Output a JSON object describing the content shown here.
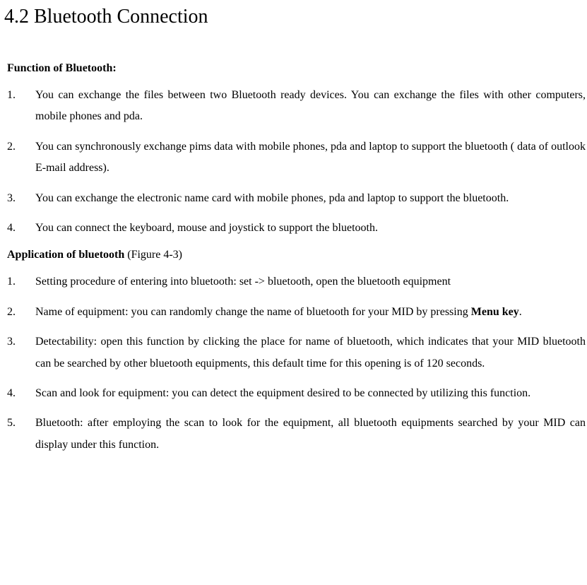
{
  "section_title": "4.2 Bluetooth Connection",
  "subheading1": "Function of Bluetooth:",
  "function_list": [
    {
      "num": "1.",
      "text": "You can exchange the files between two Bluetooth ready devices. You can exchange the files with other computers, mobile phones and pda."
    },
    {
      "num": "2.",
      "text": "You can synchronously exchange pims data with mobile phones, pda and laptop to support the bluetooth ( data of outlook E-mail address)."
    },
    {
      "num": "3.",
      "text": "You can exchange the electronic name card with mobile phones, pda and laptop to support the bluetooth."
    },
    {
      "num": "4.",
      "text": "You can connect the keyboard, mouse and joystick to support the bluetooth."
    }
  ],
  "subheading2_bold": "Application of bluetooth",
  "subheading2_rest": " (Figure 4-3)",
  "application_list": [
    {
      "num": "1.",
      "text": "Setting procedure of entering into bluetooth: set -> bluetooth, open the bluetooth equipment"
    },
    {
      "num": "2.",
      "text_before": "Name of equipment: you can randomly change the name of bluetooth for your MID by pressing ",
      "bold": "Menu key",
      "text_after": "."
    },
    {
      "num": "3.",
      "text": "Detectability: open this function by clicking the place for name of bluetooth, which indicates that your MID bluetooth can be searched by other bluetooth equipments, this default time for this opening is of 120 seconds."
    },
    {
      "num": "4.",
      "text": "Scan and look for equipment: you can detect the equipment desired to be connected by utilizing this function."
    },
    {
      "num": "5.",
      "text": "Bluetooth: after employing the scan to look for the equipment, all bluetooth equipments searched by your MID can display under this function."
    }
  ]
}
